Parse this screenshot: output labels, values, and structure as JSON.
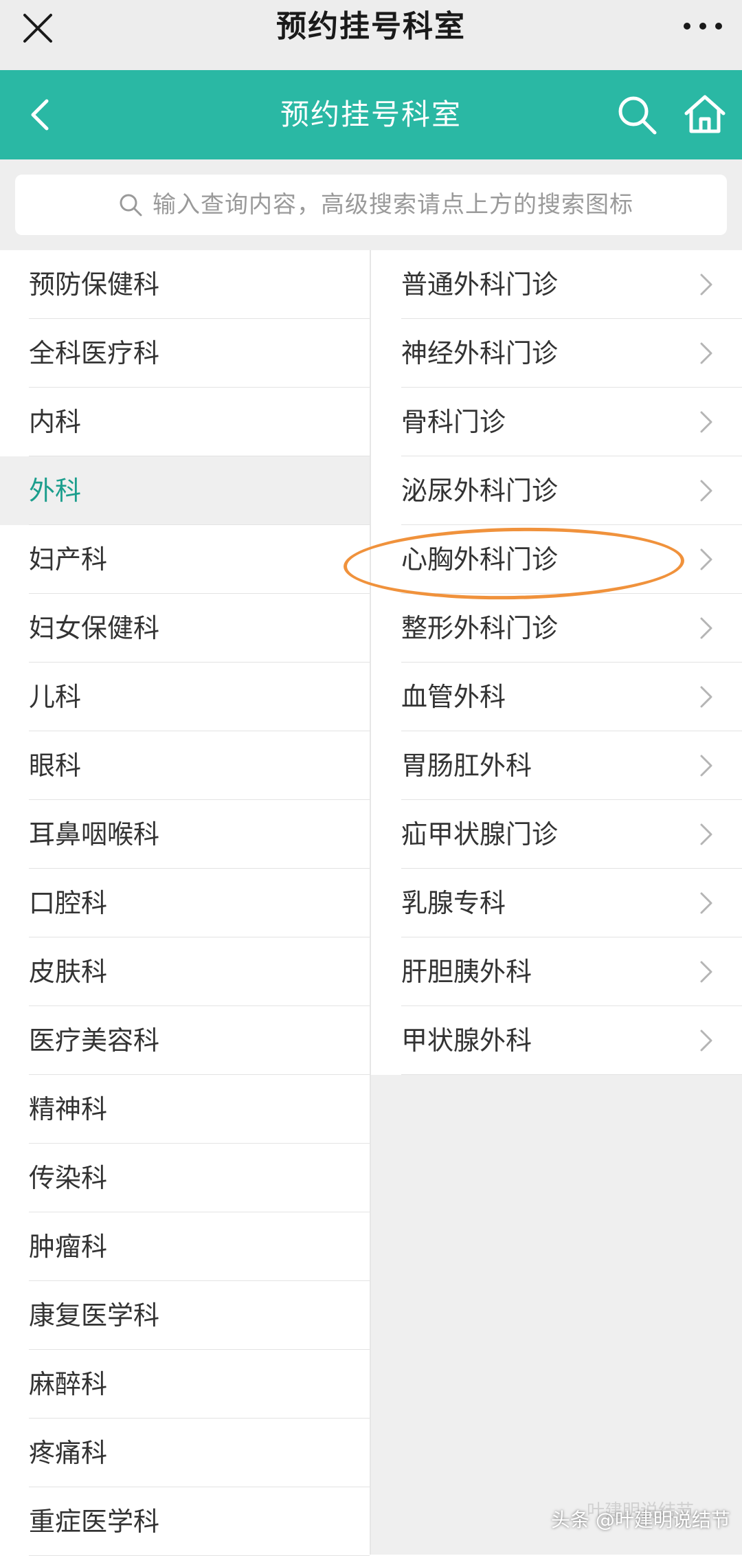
{
  "topbar": {
    "title": "预约挂号科室"
  },
  "header": {
    "title": "预约挂号科室"
  },
  "search": {
    "placeholder": "输入查询内容，高级搜索请点上方的搜索图标"
  },
  "left_menu": {
    "active_index": 3,
    "items": [
      "预防保健科",
      "全科医疗科",
      "内科",
      "外科",
      "妇产科",
      "妇女保健科",
      "儿科",
      "眼科",
      "耳鼻咽喉科",
      "口腔科",
      "皮肤科",
      "医疗美容科",
      "精神科",
      "传染科",
      "肿瘤科",
      "康复医学科",
      "麻醉科",
      "疼痛科",
      "重症医学科"
    ]
  },
  "right_menu": {
    "highlighted_index": 4,
    "items": [
      "普通外科门诊",
      "神经外科门诊",
      "骨科门诊",
      "泌尿外科门诊",
      "心胸外科门诊",
      "整形外科门诊",
      "血管外科",
      "胃肠肛外科",
      "疝甲状腺门诊",
      "乳腺专科",
      "肝胆胰外科",
      "甲状腺外科"
    ]
  },
  "colors": {
    "accent": "#2ab8a4",
    "active_text": "#1c9e8d",
    "highlight_ring": "#f0923c"
  },
  "watermark": {
    "faint": "叶建明说结节",
    "text": "头条 @叶建明说结节"
  }
}
